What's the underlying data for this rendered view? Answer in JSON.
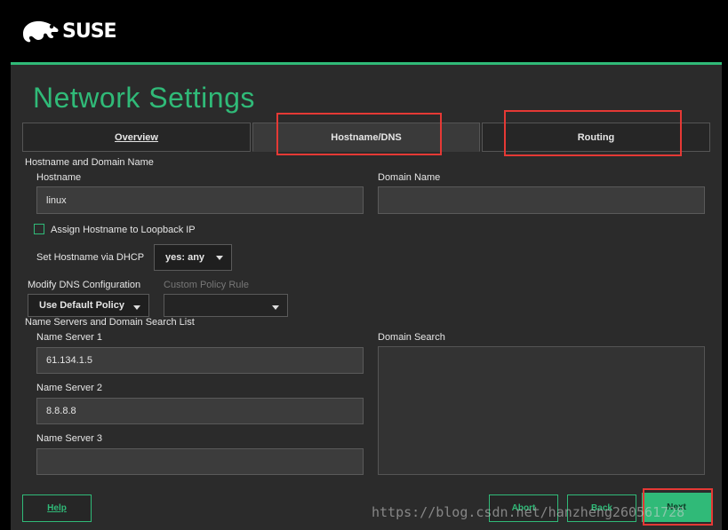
{
  "header": {
    "logo_text": "SUSE"
  },
  "page": {
    "title": "Network Settings"
  },
  "tabs": [
    {
      "label": "Overview",
      "active": false
    },
    {
      "label": "Hostname/DNS",
      "active": true
    },
    {
      "label": "Routing",
      "active": false
    }
  ],
  "hostname_section": {
    "title": "Hostname and Domain Name",
    "hostname_label": "Hostname",
    "hostname_value": "linux",
    "domain_label": "Domain Name",
    "domain_value": "",
    "loopback_label": "Assign Hostname to Loopback IP",
    "loopback_checked": false,
    "dhcp_label": "Set Hostname via DHCP",
    "dhcp_value": "yes: any"
  },
  "dns_config": {
    "modify_label": "Modify DNS Configuration",
    "modify_value": "Use Default Policy",
    "custom_label": "Custom Policy Rule",
    "custom_value": ""
  },
  "nameservers": {
    "title": "Name Servers and Domain Search List",
    "ns1_label": "Name Server 1",
    "ns1_value": "61.134.1.5",
    "ns2_label": "Name Server 2",
    "ns2_value": "8.8.8.8",
    "ns3_label": "Name Server 3",
    "ns3_value": "",
    "search_label": "Domain Search"
  },
  "buttons": {
    "help": "Help",
    "abort": "Abort",
    "back": "Back",
    "next": "Next"
  },
  "watermark": "https://blog.csdn.net/hanzheng260561728",
  "colors": {
    "accent": "#30ba78",
    "highlight": "#e53935",
    "background": "#2b2b2b"
  }
}
